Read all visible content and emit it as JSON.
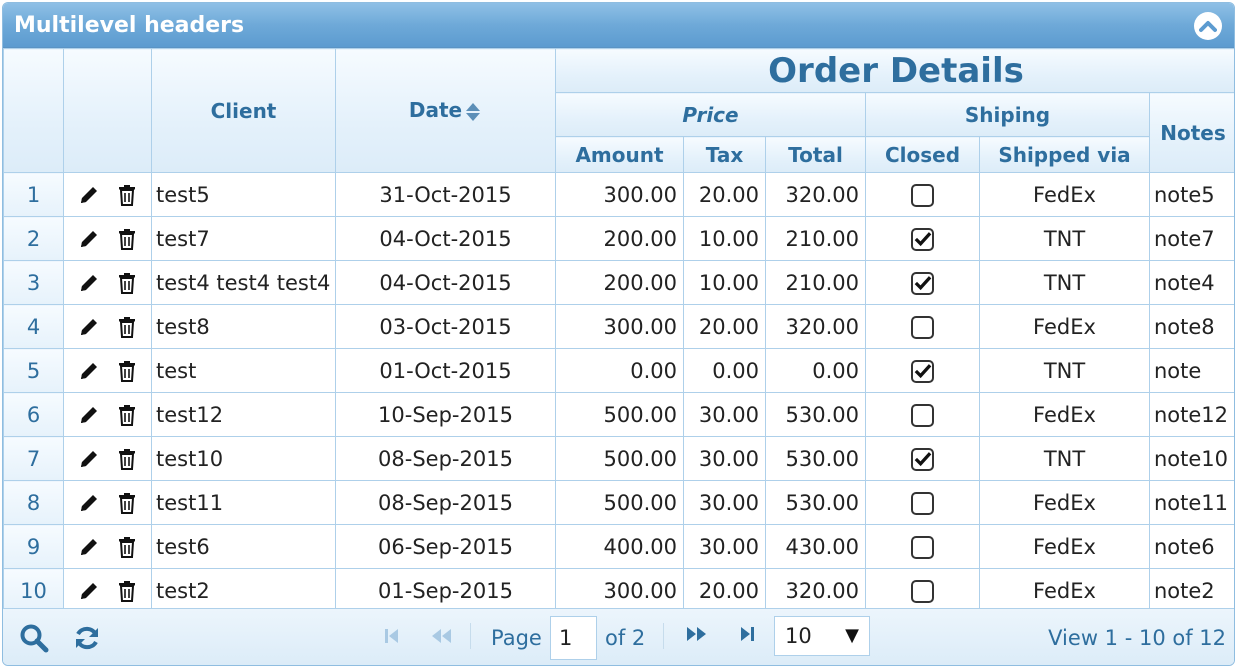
{
  "caption": {
    "title": "Multilevel headers"
  },
  "headers": {
    "client": "Client",
    "date": "Date",
    "group": "Order Details",
    "price": "Price",
    "shipping": "Shiping",
    "notes": "Notes",
    "amount": "Amount",
    "tax": "Tax",
    "total": "Total",
    "closed": "Closed",
    "shipped_via": "Shipped via"
  },
  "rows": [
    {
      "n": "1",
      "client": "test5",
      "date": "31-Oct-2015",
      "amount": "300.00",
      "tax": "20.00",
      "total": "320.00",
      "closed": false,
      "ship": "FedEx",
      "note": "note5"
    },
    {
      "n": "2",
      "client": "test7",
      "date": "04-Oct-2015",
      "amount": "200.00",
      "tax": "10.00",
      "total": "210.00",
      "closed": true,
      "ship": "TNT",
      "note": "note7"
    },
    {
      "n": "3",
      "client": "test4 test4 test4",
      "date": "04-Oct-2015",
      "amount": "200.00",
      "tax": "10.00",
      "total": "210.00",
      "closed": true,
      "ship": "TNT",
      "note": "note4"
    },
    {
      "n": "4",
      "client": "test8",
      "date": "03-Oct-2015",
      "amount": "300.00",
      "tax": "20.00",
      "total": "320.00",
      "closed": false,
      "ship": "FedEx",
      "note": "note8"
    },
    {
      "n": "5",
      "client": "test",
      "date": "01-Oct-2015",
      "amount": "0.00",
      "tax": "0.00",
      "total": "0.00",
      "closed": true,
      "ship": "TNT",
      "note": "note"
    },
    {
      "n": "6",
      "client": "test12",
      "date": "10-Sep-2015",
      "amount": "500.00",
      "tax": "30.00",
      "total": "530.00",
      "closed": false,
      "ship": "FedEx",
      "note": "note12"
    },
    {
      "n": "7",
      "client": "test10",
      "date": "08-Sep-2015",
      "amount": "500.00",
      "tax": "30.00",
      "total": "530.00",
      "closed": true,
      "ship": "TNT",
      "note": "note10"
    },
    {
      "n": "8",
      "client": "test11",
      "date": "08-Sep-2015",
      "amount": "500.00",
      "tax": "30.00",
      "total": "530.00",
      "closed": false,
      "ship": "FedEx",
      "note": "note11"
    },
    {
      "n": "9",
      "client": "test6",
      "date": "06-Sep-2015",
      "amount": "400.00",
      "tax": "30.00",
      "total": "430.00",
      "closed": false,
      "ship": "FedEx",
      "note": "note6"
    },
    {
      "n": "10",
      "client": "test2",
      "date": "01-Sep-2015",
      "amount": "300.00",
      "tax": "20.00",
      "total": "320.00",
      "closed": false,
      "ship": "FedEx",
      "note": "note2"
    }
  ],
  "pager": {
    "page_label": "Page",
    "page_value": "1",
    "of_label": "of 2",
    "rows_per_page": "10",
    "view_text": "View 1 - 10 of 12"
  },
  "icons": {
    "collapse": "chevron-up-icon",
    "edit": "pencil-icon",
    "delete": "trash-icon",
    "search": "search-icon",
    "refresh": "refresh-icon",
    "sort": "sort-icon"
  },
  "colors": {
    "caption_bg": "#6ea9d8",
    "header_text": "#2e6e9e",
    "border": "#aed0ea"
  }
}
